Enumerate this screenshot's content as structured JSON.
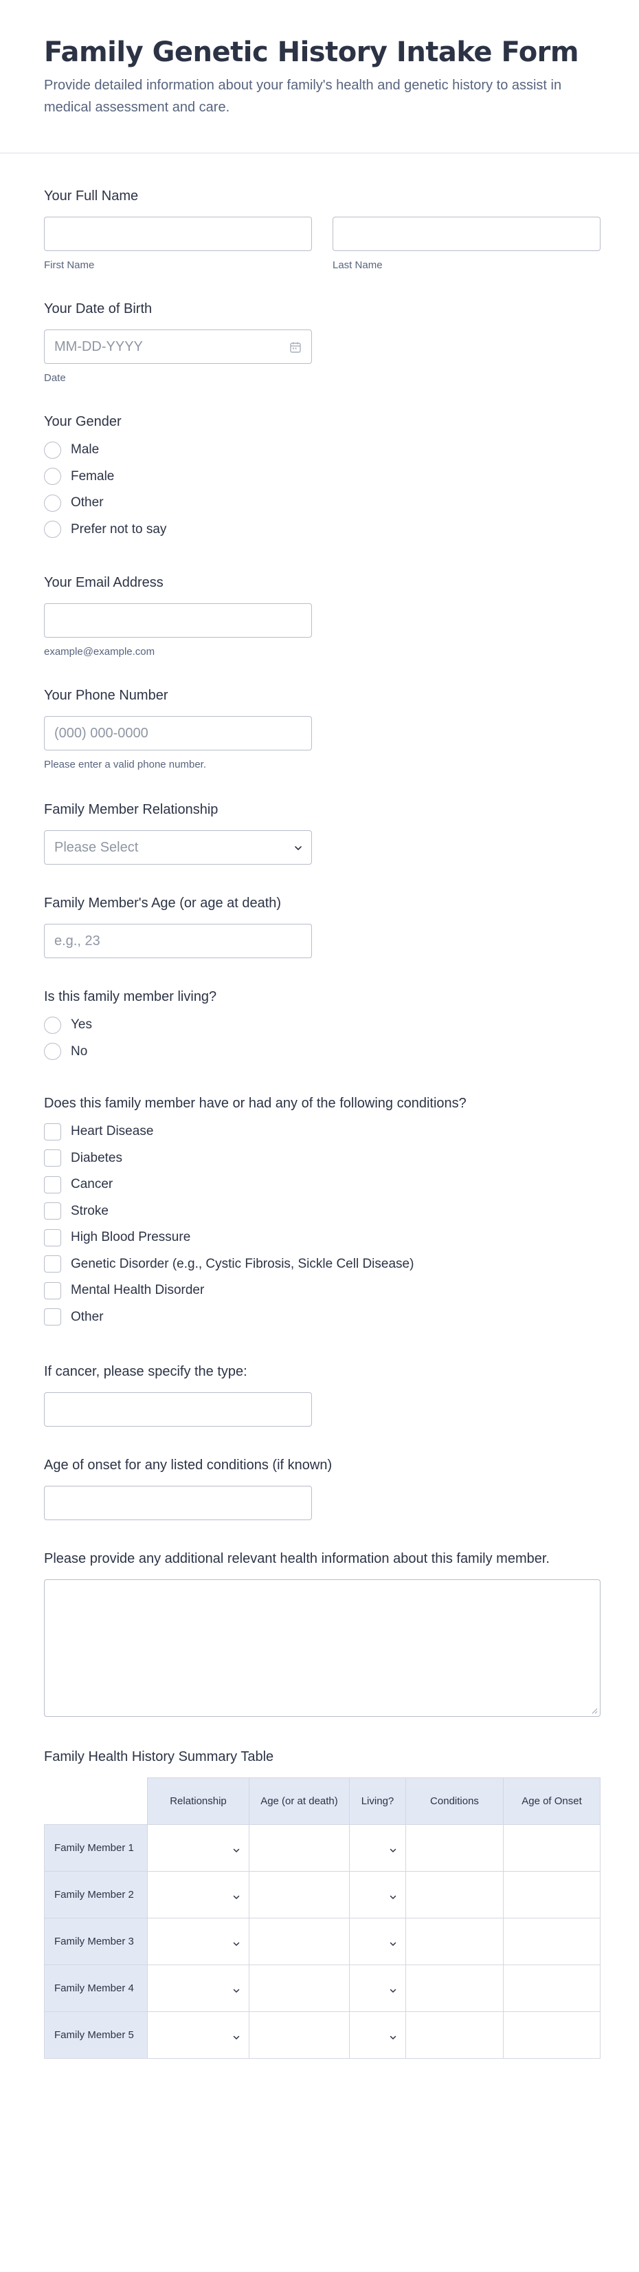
{
  "header": {
    "title": "Family Genetic History Intake Form",
    "subtitle": "Provide detailed information about your family's health and genetic history to assist in medical assessment and care."
  },
  "full_name": {
    "label": "Your Full Name",
    "first_sublabel": "First Name",
    "last_sublabel": "Last Name",
    "first_value": "",
    "last_value": ""
  },
  "dob": {
    "label": "Your Date of Birth",
    "placeholder": "MM-DD-YYYY",
    "sublabel": "Date",
    "icon": "calendar-icon"
  },
  "gender": {
    "label": "Your Gender",
    "options": [
      "Male",
      "Female",
      "Other",
      "Prefer not to say"
    ]
  },
  "email": {
    "label": "Your Email Address",
    "value": "",
    "sublabel": "example@example.com"
  },
  "phone": {
    "label": "Your Phone Number",
    "placeholder": "(000) 000-0000",
    "sublabel": "Please enter a valid phone number."
  },
  "relationship": {
    "label": "Family Member Relationship",
    "selected": "Please Select",
    "icon": "chevron-down-icon"
  },
  "member_age": {
    "label": "Family Member's Age (or age at death)",
    "placeholder": "e.g., 23"
  },
  "living": {
    "label": "Is this family member living?",
    "options": [
      "Yes",
      "No"
    ]
  },
  "conditions": {
    "label": "Does this family member have or had any of the following conditions?",
    "options": [
      "Heart Disease",
      "Diabetes",
      "Cancer",
      "Stroke",
      "High Blood Pressure",
      "Genetic Disorder (e.g., Cystic Fibrosis, Sickle Cell Disease)",
      "Mental Health Disorder",
      "Other"
    ]
  },
  "cancer_type": {
    "label": "If cancer, please specify the type:",
    "value": ""
  },
  "onset_age": {
    "label": "Age of onset for any listed conditions (if known)",
    "value": ""
  },
  "additional": {
    "label": "Please provide any additional relevant health information about this family member.",
    "value": ""
  },
  "summary": {
    "label": "Family Health History Summary Table",
    "columns": [
      "Relationship",
      "Age (or at death)",
      "Living?",
      "Conditions",
      "Age of Onset"
    ],
    "rows": [
      "Family Member 1",
      "Family Member 2",
      "Family Member 3",
      "Family Member 4",
      "Family Member 5"
    ],
    "dropdown_columns": [
      "Relationship",
      "Living?"
    ]
  },
  "colors": {
    "title": "#2c3345",
    "subtitle": "#57647e",
    "border": "#b8bdc9",
    "table_header_bg": "#e3e8f5"
  }
}
